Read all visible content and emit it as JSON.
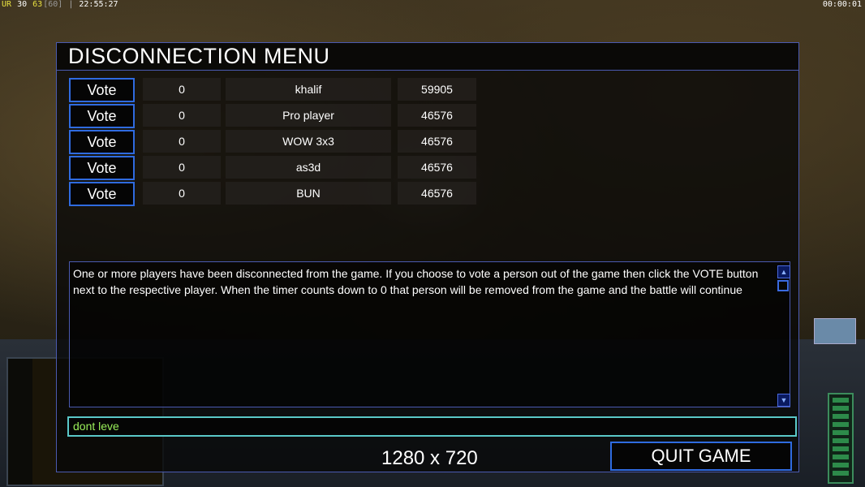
{
  "hud": {
    "ur": "UR",
    "n1": "30",
    "n2": "63",
    "n3": "[60]",
    "clock": "22:55:27",
    "timer": "00:00:01"
  },
  "colors": {
    "accent_blue": "#2f6be0",
    "border": "#4a5ab0",
    "chat_text": "#9af05a",
    "chat_border": "#5ac8c8"
  },
  "dialog": {
    "title": "DISCONNECTION MENU",
    "players": [
      {
        "vote_label": "Vote",
        "count": "0",
        "name": "khalif",
        "ping": "59905"
      },
      {
        "vote_label": "Vote",
        "count": "0",
        "name": "Pro player",
        "ping": "46576"
      },
      {
        "vote_label": "Vote",
        "count": "0",
        "name": "WOW 3x3",
        "ping": "46576"
      },
      {
        "vote_label": "Vote",
        "count": "0",
        "name": "as3d",
        "ping": "46576"
      },
      {
        "vote_label": "Vote",
        "count": "0",
        "name": "BUN",
        "ping": "46576"
      }
    ],
    "message": "One or more players have been disconnected from the game. If you choose to vote a person out of the game then click the VOTE button next to the respective player. When the timer counts down to 0 that person will be removed from the game and the battle will continue",
    "chat_value": "dont leve",
    "quit_label": "QUIT GAME",
    "resolution": "1280 x 720"
  },
  "icons": {
    "scroll_up": "scroll-up-icon",
    "scroll_down": "scroll-down-icon"
  }
}
